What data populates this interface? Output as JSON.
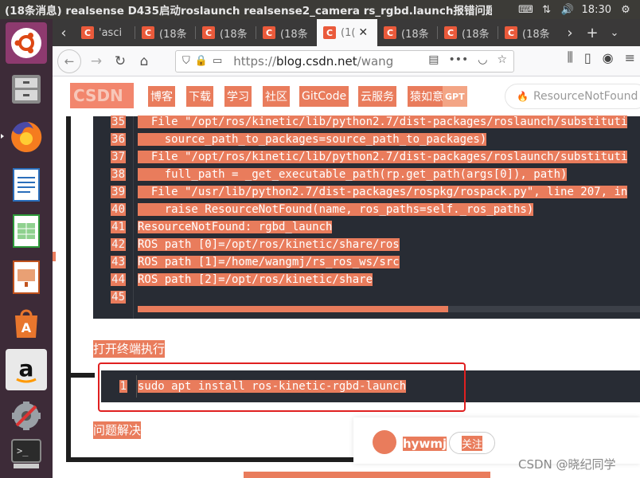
{
  "window": {
    "title": "(18条消息) realsense D435启动roslaunch realsense2_camera rs_rgbd.launch报错问题（",
    "time": "18:30"
  },
  "tray": {
    "kbd": "⌨",
    "net": "⇅",
    "vol": "🔊",
    "power": "⚙"
  },
  "tabs": [
    {
      "label": "'asci",
      "fav": "C"
    },
    {
      "label": "(18条",
      "fav": "C"
    },
    {
      "label": "(18条",
      "fav": "C"
    },
    {
      "label": "(18条",
      "fav": "C"
    },
    {
      "label": "(1(",
      "fav": "C",
      "active": true
    },
    {
      "label": "(18条",
      "fav": "C"
    },
    {
      "label": "(18条",
      "fav": "C"
    },
    {
      "label": "(18条",
      "fav": "C"
    }
  ],
  "url": {
    "prefix": "https://",
    "host": "blog.csdn.net",
    "path": "/wangm"
  },
  "header": {
    "logo": "CSDN",
    "nav": [
      "博客",
      "下载",
      "学习",
      "社区",
      "GitCode",
      "云服务",
      "猿如意"
    ],
    "gpt": "GPT",
    "search_text": "ResourceNotFound"
  },
  "code1": {
    "lines": [
      {
        "n": "35",
        "text": "  File \"/opt/ros/kinetic/lib/python2.7/dist-packages/roslaunch/substituti"
      },
      {
        "n": "36",
        "text": "    source_path_to_packages=source_path_to_packages)"
      },
      {
        "n": "37",
        "text": "  File \"/opt/ros/kinetic/lib/python2.7/dist-packages/roslaunch/substituti"
      },
      {
        "n": "38",
        "text": "    full_path = _get_executable_path(rp.get_path(args[0]), path)"
      },
      {
        "n": "39",
        "text": "  File \"/usr/lib/python2.7/dist-packages/rospkg/rospack.py\", line 207, in"
      },
      {
        "n": "40",
        "text": "    raise ResourceNotFound(name, ros_paths=self._ros_paths)"
      },
      {
        "n": "41",
        "text": "ResourceNotFound: rgbd_launch"
      },
      {
        "n": "42",
        "text": "ROS path [0]=/opt/ros/kinetic/share/ros"
      },
      {
        "n": "43",
        "text": "ROS path [1]=/home/wangmj/rs_ros_ws/src"
      },
      {
        "n": "44",
        "text": "ROS path [2]=/opt/ros/kinetic/share"
      },
      {
        "n": "45",
        "text": ""
      }
    ]
  },
  "section1": "打开终端执行",
  "code2": {
    "n": "1",
    "text": "sudo apt install ros-kinetic-rgbd-launch"
  },
  "section2": "问题解决",
  "author": {
    "name": "hywmj",
    "follow": "关注"
  },
  "watermark": "CSDN @晓纪同学"
}
